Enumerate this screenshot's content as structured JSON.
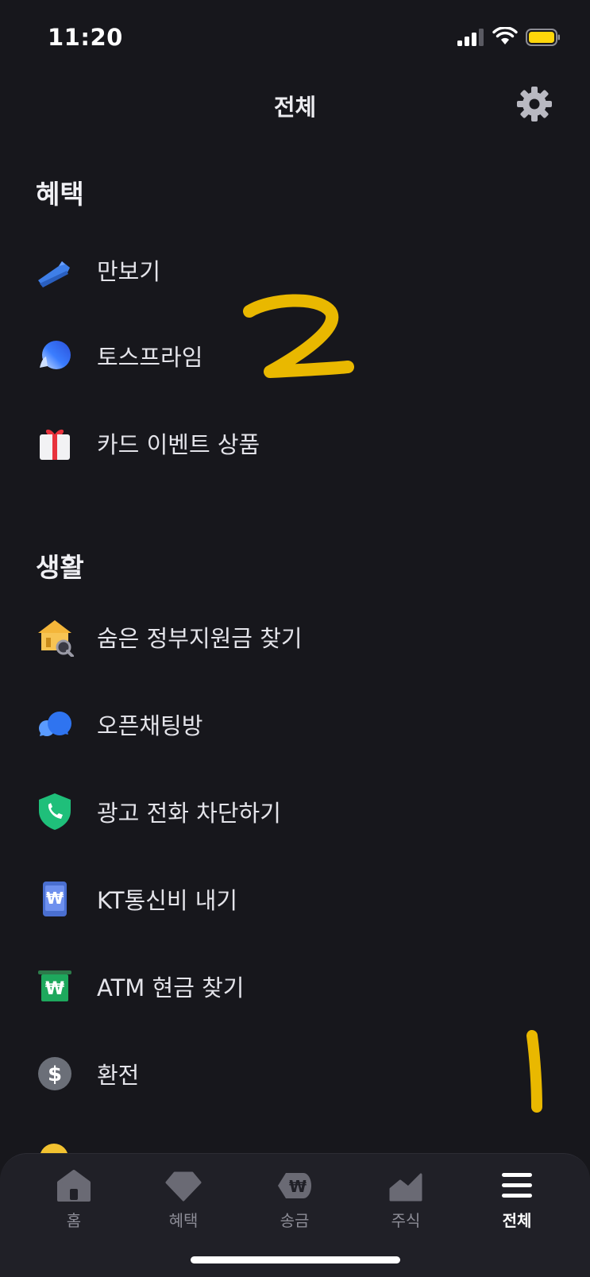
{
  "status_bar": {
    "time": "11:20"
  },
  "header": {
    "title": "전체",
    "settings_icon": "gear-icon"
  },
  "sections": [
    {
      "title": "혜택",
      "items": [
        {
          "label": "만보기",
          "icon": "sneaker-icon"
        },
        {
          "label": "토스프라임",
          "icon": "prime-bubble-icon"
        },
        {
          "label": "카드 이벤트 상품",
          "icon": "gift-icon"
        }
      ]
    },
    {
      "title": "생활",
      "items": [
        {
          "label": "숨은 정부지원금 찾기",
          "icon": "government-building-icon"
        },
        {
          "label": "오픈채팅방",
          "icon": "chat-bubbles-icon"
        },
        {
          "label": "광고 전화 차단하기",
          "icon": "shield-phone-icon"
        },
        {
          "label": "KT통신비 내기",
          "icon": "phone-won-icon"
        },
        {
          "label": "ATM 현금 찾기",
          "icon": "atm-won-icon"
        },
        {
          "label": "환전",
          "icon": "dollar-coin-icon"
        }
      ]
    }
  ],
  "annotations": {
    "mark_1": "1",
    "mark_2": "2"
  },
  "tabbar": {
    "tabs": [
      {
        "label": "홈",
        "icon": "home-icon",
        "active": false
      },
      {
        "label": "혜택",
        "icon": "diamond-icon",
        "active": false
      },
      {
        "label": "송금",
        "icon": "won-transfer-icon",
        "active": false
      },
      {
        "label": "주식",
        "icon": "stock-chart-icon",
        "active": false
      },
      {
        "label": "전체",
        "icon": "menu-icon",
        "active": true
      }
    ]
  },
  "colors": {
    "background": "#17171c",
    "tabbar": "#202027",
    "annotation": "#f2c200",
    "accent_blue": "#3182f6",
    "battery": "#ffd60a"
  }
}
